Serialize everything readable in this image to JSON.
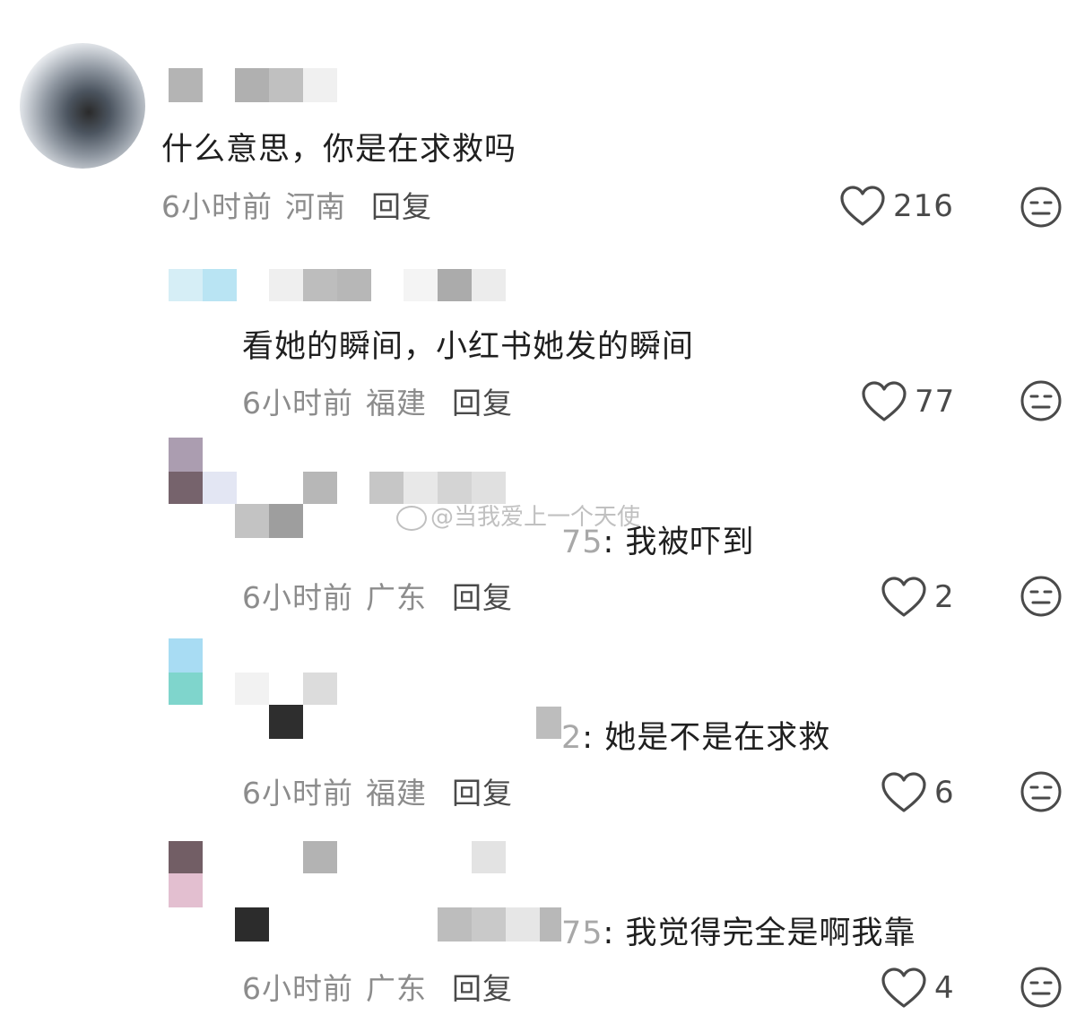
{
  "comments": [
    {
      "text": "什么意思，你是在求救吗",
      "time": "6小时前",
      "region": "河南",
      "reply_label": "回复",
      "likes": "216"
    },
    {
      "text": "看她的瞬间，小红书她发的瞬间",
      "time": "6小时前",
      "region": "福建",
      "reply_label": "回复",
      "likes": "77"
    },
    {
      "prefix": "75",
      "text": ": 我被吓到",
      "time": "6小时前",
      "region": "广东",
      "reply_label": "回复",
      "likes": "2"
    },
    {
      "prefix": "2",
      "text": ": 她是不是在求救",
      "time": "6小时前",
      "region": "福建",
      "reply_label": "回复",
      "likes": "6"
    },
    {
      "prefix": "75",
      "text": ": 我觉得完全是啊我靠",
      "time": "6小时前",
      "region": "广东",
      "reply_label": "回复",
      "likes": "4"
    }
  ],
  "watermark": "@当我爱上一个天使",
  "colors": {
    "meta": "#8c8c8c",
    "text": "#1f1f1f",
    "icon": "#4a4a4a"
  }
}
